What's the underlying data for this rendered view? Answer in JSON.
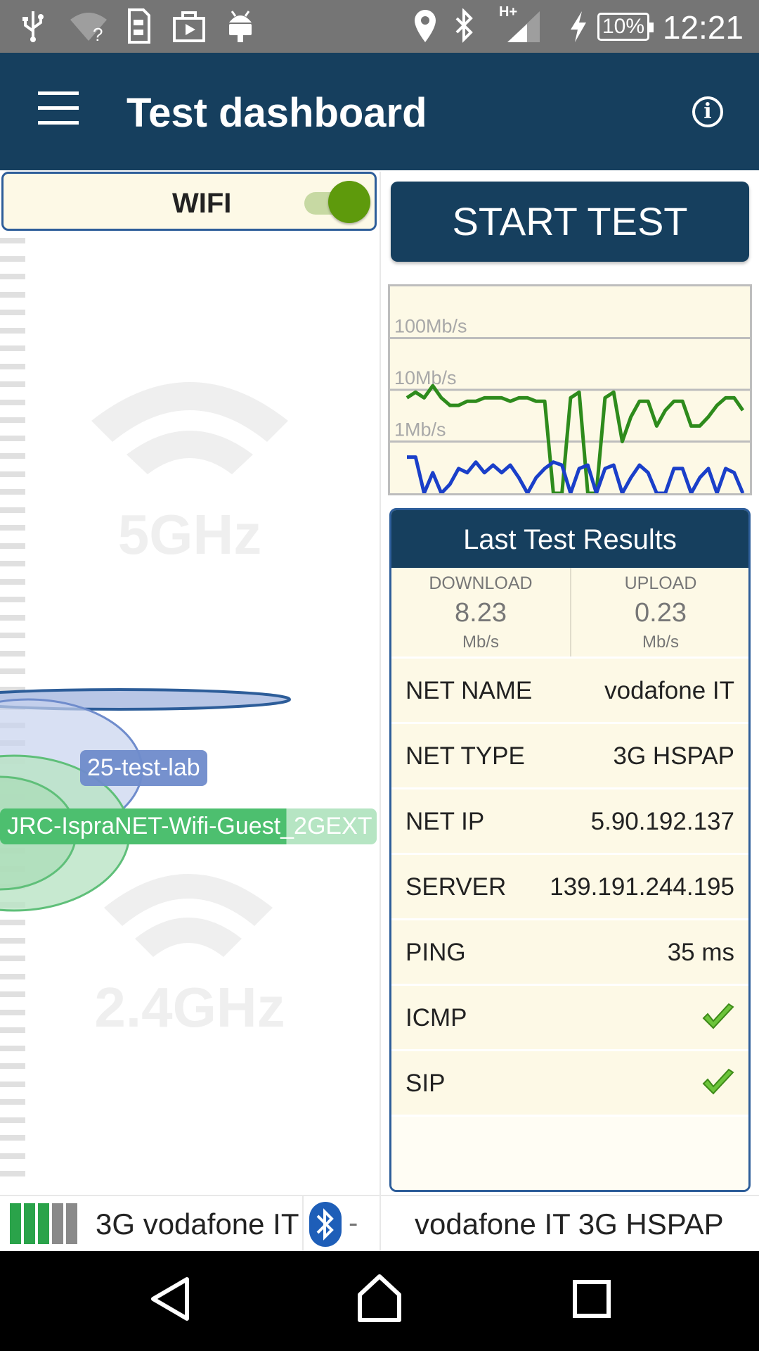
{
  "status_bar": {
    "time": "12:21",
    "battery": "10%",
    "icons": [
      "usb-icon",
      "wifi-unknown-icon",
      "sim-icon",
      "media-icon",
      "android-icon",
      "location-icon",
      "bluetooth-icon",
      "signal-icon",
      "charging-icon",
      "battery-icon"
    ],
    "network_type": "H+"
  },
  "app_bar": {
    "title": "Test dashboard",
    "menu_icon": "menu-icon",
    "info_icon": "info-icon",
    "info_glyph": "i"
  },
  "wifi_panel": {
    "toggle_label": "WIFI",
    "toggle_on": true,
    "band_high": "5GHz",
    "band_low": "2.4GHz",
    "networks": [
      {
        "ssid": "25-test-lab"
      },
      {
        "ssid": "JRC-IspraNET-Wifi-Guest_2GEXT"
      }
    ]
  },
  "start_button": {
    "label": "START TEST"
  },
  "chart_data": {
    "type": "line",
    "title": "",
    "xlabel": "",
    "ylabel": "",
    "yscale": "log",
    "ytick_labels": [
      "100Mb/s",
      "10Mb/s",
      "1Mb/s"
    ],
    "ylim": [
      0.1,
      1000
    ],
    "grid": true,
    "series": [
      {
        "color": "#2e8b1c",
        "values": [
          7,
          9,
          7,
          12,
          7,
          5,
          5,
          6,
          6,
          7,
          7,
          7,
          6,
          7,
          7,
          6,
          6,
          0.1,
          0.1,
          7,
          9,
          0.1,
          0.1,
          7,
          9,
          1,
          3,
          6,
          6,
          2,
          4,
          6,
          6,
          2,
          2,
          3,
          5,
          7,
          7,
          4
        ]
      },
      {
        "color": "#1a3fc9",
        "values": [
          0.5,
          0.5,
          0.1,
          0.25,
          0.1,
          0.15,
          0.3,
          0.25,
          0.4,
          0.25,
          0.35,
          0.25,
          0.35,
          0.2,
          0.1,
          0.2,
          0.3,
          0.4,
          0.35,
          0.1,
          0.3,
          0.35,
          0.1,
          0.3,
          0.35,
          0.1,
          0.2,
          0.35,
          0.25,
          0.1,
          0.1,
          0.3,
          0.3,
          0.1,
          0.2,
          0.3,
          0.1,
          0.3,
          0.25,
          0.1
        ]
      }
    ]
  },
  "results": {
    "title": "Last Test Results",
    "download": {
      "label": "DOWNLOAD",
      "value": "8.23",
      "unit": "Mb/s"
    },
    "upload": {
      "label": "UPLOAD",
      "value": "0.23",
      "unit": "Mb/s"
    },
    "rows": [
      {
        "key": "NET NAME",
        "value": "vodafone IT"
      },
      {
        "key": "NET TYPE",
        "value": "3G HSPAP"
      },
      {
        "key": "NET IP",
        "value": "5.90.192.137"
      },
      {
        "key": "SERVER",
        "value": "139.191.244.195"
      },
      {
        "key": "PING",
        "value": "35 ms"
      },
      {
        "key": "ICMP",
        "value": "check-icon"
      },
      {
        "key": "SIP",
        "value": "check-icon"
      }
    ]
  },
  "bottom_strip": {
    "network_left": "3G vodafone IT",
    "bluetooth_status": "-",
    "network_right": "vodafone IT 3G HSPAP",
    "signal_colors": [
      "#2aa34a",
      "#2aa34a",
      "#2aa34a",
      "#8a8a8a",
      "#8a8a8a"
    ]
  },
  "nav_bar": {
    "icons": [
      "back-icon",
      "home-icon",
      "recents-icon"
    ]
  },
  "colors": {
    "primary": "#163f5e",
    "panel_bg": "#fdf9e6",
    "accent_green": "#5e9a0c",
    "border_blue": "#2d5d99"
  }
}
